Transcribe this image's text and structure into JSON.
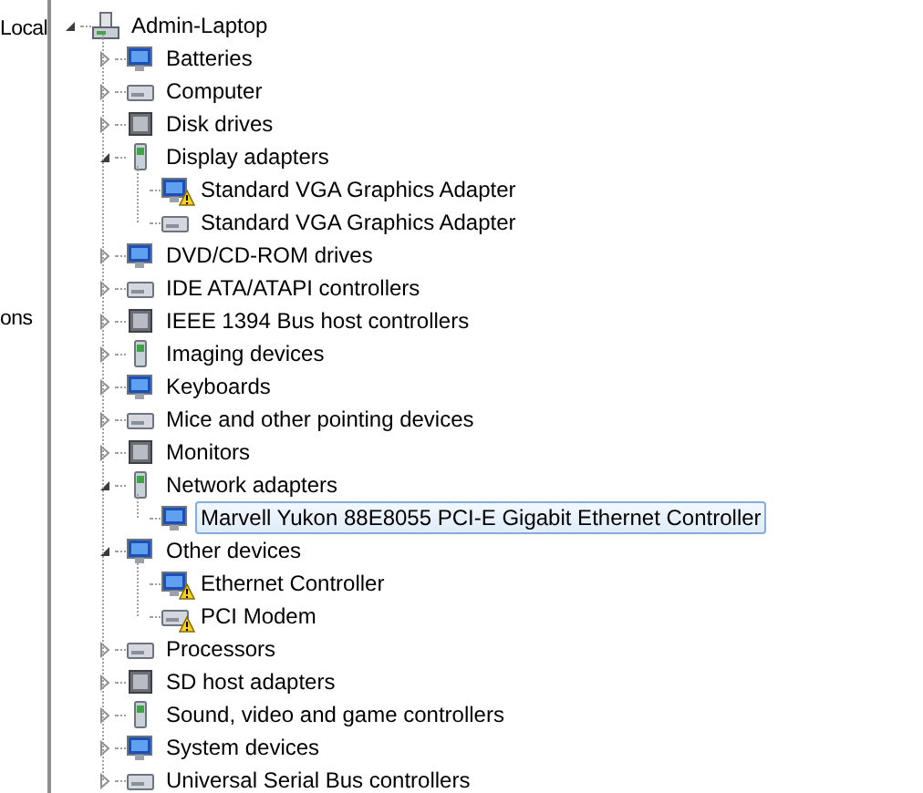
{
  "left_pane": {
    "texts": [
      "Local",
      "ons"
    ]
  },
  "tree": {
    "label": "Admin-Laptop",
    "expanded": true,
    "children": [
      {
        "label": "Batteries",
        "expanded": false
      },
      {
        "label": "Computer",
        "expanded": false
      },
      {
        "label": "Disk drives",
        "expanded": false
      },
      {
        "label": "Display adapters",
        "expanded": true,
        "children": [
          {
            "label": "Standard VGA Graphics Adapter",
            "warning": true
          },
          {
            "label": "Standard VGA Graphics Adapter",
            "warning": false
          }
        ]
      },
      {
        "label": "DVD/CD-ROM drives",
        "expanded": false
      },
      {
        "label": "IDE ATA/ATAPI controllers",
        "expanded": false
      },
      {
        "label": "IEEE 1394 Bus host controllers",
        "expanded": false
      },
      {
        "label": "Imaging devices",
        "expanded": false
      },
      {
        "label": "Keyboards",
        "expanded": false
      },
      {
        "label": "Mice and other pointing devices",
        "expanded": false
      },
      {
        "label": "Monitors",
        "expanded": false
      },
      {
        "label": "Network adapters",
        "expanded": true,
        "children": [
          {
            "label": "Marvell Yukon 88E8055 PCI-E Gigabit Ethernet Controller",
            "warning": false,
            "selected": true
          }
        ]
      },
      {
        "label": "Other devices",
        "expanded": true,
        "children": [
          {
            "label": "Ethernet Controller",
            "warning": true
          },
          {
            "label": "PCI Modem",
            "warning": true
          }
        ]
      },
      {
        "label": "Processors",
        "expanded": false
      },
      {
        "label": "SD host adapters",
        "expanded": false
      },
      {
        "label": "Sound, video and game controllers",
        "expanded": false
      },
      {
        "label": "System devices",
        "expanded": false
      },
      {
        "label": "Universal Serial Bus controllers",
        "expanded": false
      }
    ]
  }
}
